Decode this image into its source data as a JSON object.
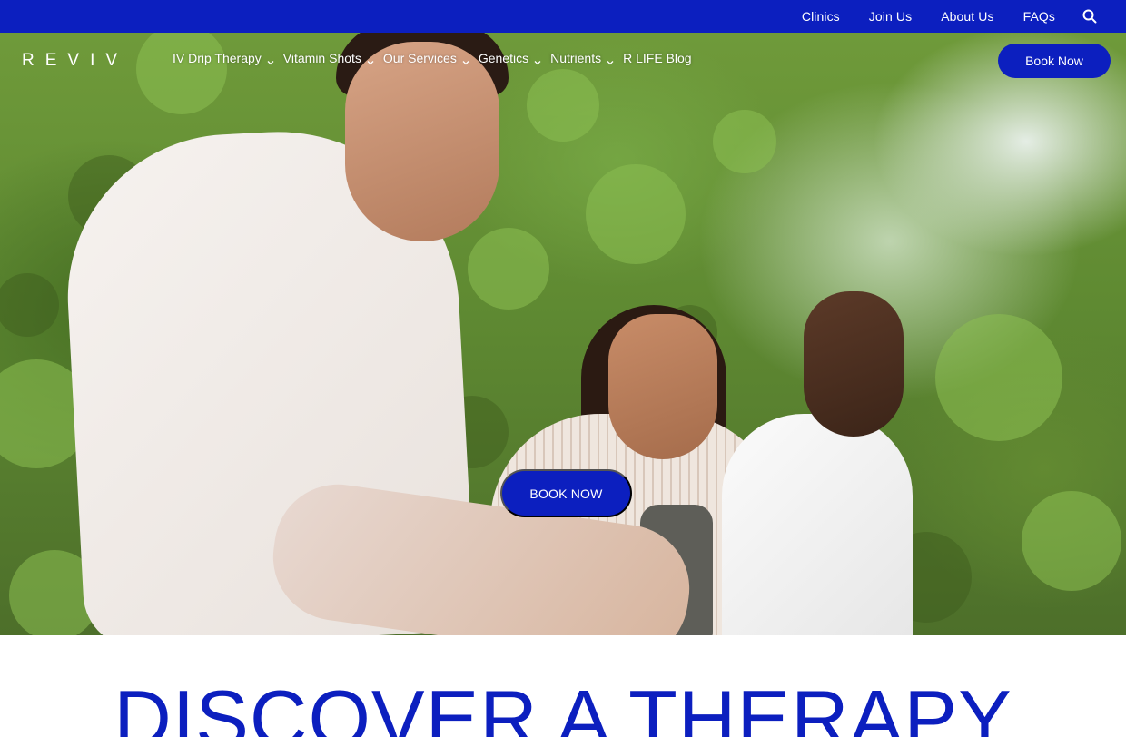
{
  "topbar": {
    "links": [
      "Clinics",
      "Join Us",
      "About Us",
      "FAQs"
    ],
    "search_icon": "search-icon"
  },
  "brand": {
    "logo_text": "REVIV"
  },
  "nav": {
    "items": [
      {
        "label": "IV Drip Therapy",
        "has_dropdown": true
      },
      {
        "label": "Vitamin Shots",
        "has_dropdown": true
      },
      {
        "label": "Our Services",
        "has_dropdown": true
      },
      {
        "label": "Genetics",
        "has_dropdown": true
      },
      {
        "label": "Nutrients",
        "has_dropdown": true
      },
      {
        "label": "R LIFE Blog",
        "has_dropdown": false
      }
    ],
    "book_label": "Book Now"
  },
  "hero": {
    "cta_label": "BOOK NOW"
  },
  "section": {
    "heading": "DISCOVER A THERAPY"
  },
  "colors": {
    "brand_blue": "#0c1fbf",
    "white": "#ffffff"
  }
}
